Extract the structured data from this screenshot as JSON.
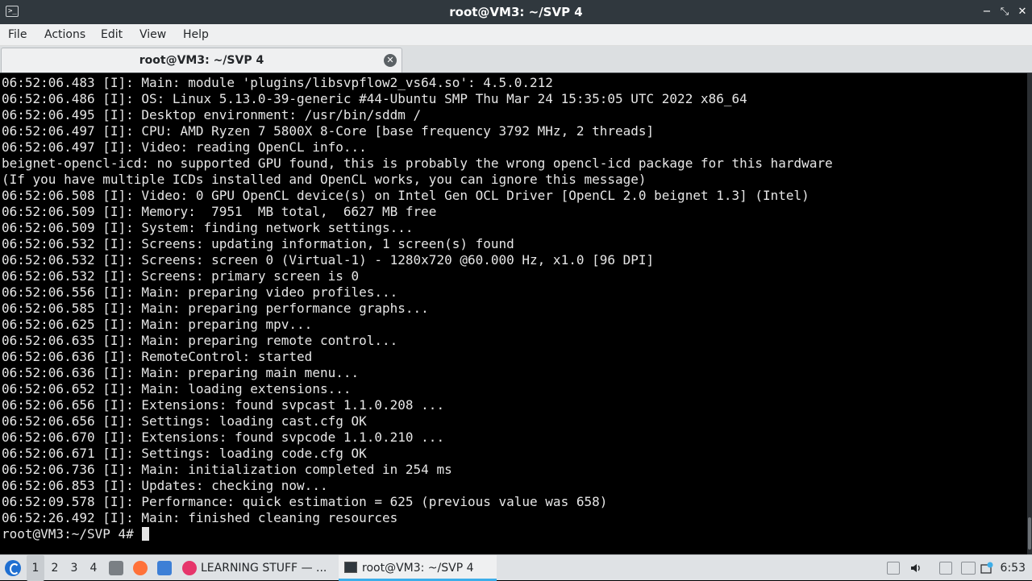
{
  "window": {
    "title": "root@VM3: ~/SVP 4",
    "minimize": "−",
    "restore": "⤡",
    "close": "✕"
  },
  "menu": [
    "File",
    "Actions",
    "Edit",
    "View",
    "Help"
  ],
  "tab": {
    "label": "root@VM3: ~/SVP 4",
    "close": "✕"
  },
  "terminal": {
    "lines": [
      "06:52:06.483 [I]: Main: module 'plugins/libsvpflow2_vs64.so': 4.5.0.212",
      "06:52:06.486 [I]: OS: Linux 5.13.0-39-generic #44-Ubuntu SMP Thu Mar 24 15:35:05 UTC 2022 x86_64",
      "06:52:06.495 [I]: Desktop environment: /usr/bin/sddm /",
      "06:52:06.497 [I]: CPU: AMD Ryzen 7 5800X 8-Core [base frequency 3792 MHz, 2 threads]",
      "06:52:06.497 [I]: Video: reading OpenCL info...",
      "beignet-opencl-icd: no supported GPU found, this is probably the wrong opencl-icd package for this hardware",
      "(If you have multiple ICDs installed and OpenCL works, you can ignore this message)",
      "06:52:06.508 [I]: Video: 0 GPU OpenCL device(s) on Intel Gen OCL Driver [OpenCL 2.0 beignet 1.3] (Intel)",
      "06:52:06.509 [I]: Memory:  7951  MB total,  6627 MB free",
      "06:52:06.509 [I]: System: finding network settings...",
      "06:52:06.532 [I]: Screens: updating information, 1 screen(s) found",
      "06:52:06.532 [I]: Screens: screen 0 (Virtual-1) - 1280x720 @60.000 Hz, x1.0 [96 DPI]",
      "06:52:06.532 [I]: Screens: primary screen is 0",
      "06:52:06.556 [I]: Main: preparing video profiles...",
      "06:52:06.585 [I]: Main: preparing performance graphs...",
      "06:52:06.625 [I]: Main: preparing mpv...",
      "06:52:06.635 [I]: Main: preparing remote control...",
      "06:52:06.636 [I]: RemoteControl: started",
      "06:52:06.636 [I]: Main: preparing main menu...",
      "06:52:06.652 [I]: Main: loading extensions...",
      "06:52:06.656 [I]: Extensions: found svpcast 1.1.0.208 ...",
      "06:52:06.656 [I]: Settings: loading cast.cfg OK",
      "06:52:06.670 [I]: Extensions: found svpcode 1.1.0.210 ...",
      "06:52:06.671 [I]: Settings: loading code.cfg OK",
      "06:52:06.736 [I]: Main: initialization completed in 254 ms",
      "06:52:06.853 [I]: Updates: checking now...",
      "06:52:09.578 [I]: Performance: quick estimation = 625 (previous value was 658)",
      "06:52:26.492 [I]: Main: finished cleaning resources"
    ],
    "prompt": "root@VM3:~/SVP 4# "
  },
  "taskbar": {
    "workspaces": [
      "1",
      "2",
      "3",
      "4"
    ],
    "active_workspace": "1",
    "quick_launch": [
      "file-manager-icon",
      "firefox-icon",
      "desktop-icon"
    ],
    "tasks": [
      {
        "label": "LEARNING STUFF — ...",
        "icon": "firefox-icon",
        "active": false
      },
      {
        "label": "root@VM3: ~/SVP 4",
        "icon": "terminal-icon",
        "active": true
      }
    ],
    "clock": "6:53"
  },
  "colors": {
    "titlebar": "#30383e",
    "accent": "#3daee9",
    "terminal_bg": "#000000",
    "terminal_fg": "#e6e6e6"
  }
}
